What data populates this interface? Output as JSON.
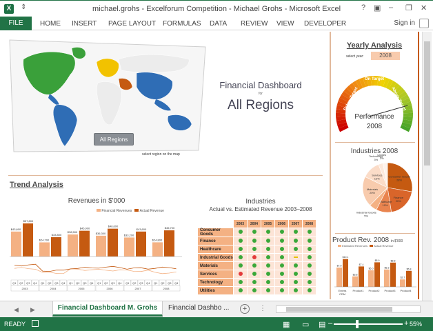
{
  "window": {
    "title": "michael.grohs - Excelforum Competition - Michael Grohs - Microsoft Excel",
    "help": "?",
    "minimize": "–",
    "restore": "❐",
    "close": "✕"
  },
  "ribbon": {
    "file": "FILE",
    "tabs": [
      "HOME",
      "INSERT",
      "PAGE LAYOUT",
      "FORMULAS",
      "DATA",
      "REVIEW",
      "VIEW",
      "DEVELOPER"
    ],
    "signin": "Sign in"
  },
  "dashboard": {
    "title": "Financial Dashboard",
    "for": "for",
    "region": "All Regions",
    "map_button": "All Regions",
    "map_hint": "select region on the map",
    "colors": {
      "americas": "#2f6db5",
      "north": "#3aa03a",
      "europe": "#f2c200",
      "mideast": "#c55a11",
      "asia": "#2f6db5"
    }
  },
  "trend": {
    "title": "Trend Analysis",
    "revenue_title": "Revenues in $'000",
    "legend_fin": "Financial Revenues",
    "legend_act": "Actual Revenue"
  },
  "chart_data": {
    "type": "bar",
    "title": "Revenues in $'000",
    "categories": [
      "2003",
      "2004",
      "2005",
      "2006",
      "2007",
      "2008"
    ],
    "series": [
      {
        "name": "Financial Revenues",
        "values": [
          43600,
          24700,
          38500,
          36300,
          33200,
          24800
        ]
      },
      {
        "name": "Actual Revenue",
        "values": [
          57800,
          33800,
          45000,
          48600,
          43600,
          45700
        ]
      }
    ],
    "labels": {
      "fin": [
        "$43,600",
        "$24,700",
        "$38,500",
        "$36,300",
        "$33,200",
        "$24,800"
      ],
      "act": [
        "$57,800",
        "$33,800",
        "$45,000",
        "$48,600",
        "$43,600",
        "$45,700"
      ]
    },
    "quarters": [
      "Q1",
      "Q2",
      "Q3",
      "Q4"
    ],
    "ylim": [
      0,
      65000
    ]
  },
  "industries": {
    "title": "Industries",
    "subtitle": "Actual vs. Estimated Revenue 2003–2008",
    "years": [
      "2003",
      "2004",
      "2005",
      "2006",
      "2007",
      "2008"
    ],
    "rows": [
      {
        "label": "Consumer Goods",
        "status": [
          "g",
          "g",
          "g",
          "g",
          "g",
          "g"
        ]
      },
      {
        "label": "Finance",
        "status": [
          "g",
          "g",
          "g",
          "g",
          "g",
          "g"
        ]
      },
      {
        "label": "Healthcare",
        "status": [
          "g",
          "g",
          "g",
          "g",
          "g",
          "g"
        ]
      },
      {
        "label": "Industrial Goods",
        "status": [
          "g",
          "r",
          "g",
          "g",
          "y",
          "g"
        ]
      },
      {
        "label": "Materials",
        "status": [
          "g",
          "g",
          "g",
          "g",
          "g",
          "g"
        ]
      },
      {
        "label": "Services",
        "status": [
          "r",
          "g",
          "g",
          "g",
          "g",
          "g"
        ]
      },
      {
        "label": "Technology",
        "status": [
          "g",
          "g",
          "g",
          "g",
          "g",
          "g"
        ]
      },
      {
        "label": "Utilities",
        "status": [
          "g",
          "g",
          "g",
          "g",
          "g",
          "g"
        ]
      }
    ]
  },
  "yearly": {
    "title": "Yearly Analysis",
    "select_label": "select year:",
    "year": "2008",
    "below": "Below Target",
    "on": "On Target",
    "above": "Above Target",
    "performance": "Performance",
    "perf_year": "2008",
    "needle_fraction": 0.82
  },
  "industries2008": {
    "title": "Industries 2008",
    "slices": [
      {
        "label": "Consumer Goods",
        "pct": 28,
        "text": "Consumer Goods 28%",
        "color": "#c55a11"
      },
      {
        "label": "Finance",
        "pct": 20,
        "text": "Finance 20%",
        "color": "#d9652a"
      },
      {
        "label": "Healthcare",
        "pct": 10,
        "text": "Healthcare 10%",
        "color": "#e9844f"
      },
      {
        "label": "Industrial Goods",
        "pct": 5,
        "text": "Industrial Goods 5%",
        "color": "#f4b183"
      },
      {
        "label": "Materials",
        "pct": 20,
        "text": "Materials 20%",
        "color": "#f8cbad"
      },
      {
        "label": "Services",
        "pct": 12,
        "text": "Services 12%",
        "color": "#fbdcc8"
      },
      {
        "label": "Technology",
        "pct": 3,
        "text": "Technology 3%",
        "color": "#fde9dc"
      },
      {
        "label": "Utilities",
        "pct": 3,
        "text": "Utilities 3%",
        "color": "#fef3ec"
      }
    ]
  },
  "product": {
    "title": "Product Rev. 2008",
    "unit": "in $'000",
    "legend_est": "Estimated Revenues",
    "legend_act": "Actual Revenue",
    "products": [
      "Entera CRM",
      "Product1",
      "Product2",
      "Product3",
      "Product4"
    ],
    "est": [
      7.0,
      3.8,
      6.0,
      6.3,
      2.7
    ],
    "act": [
      10.1,
      7.4,
      8.9,
      8.8,
      5.8
    ],
    "est_labels": [
      "$7.0",
      "$3.8",
      "$6.0",
      "$6.3",
      "$2.7"
    ],
    "act_labels": [
      "$10.1",
      "$7.4",
      "$8.9",
      "$8.8",
      "$5.8"
    ],
    "ylim": [
      0,
      12
    ]
  },
  "sheets": {
    "active": "Financial Dashboard M. Grohs",
    "other": "Financial Dashbo ...",
    "add": "+"
  },
  "status": {
    "ready": "READY",
    "zoom": "55%",
    "zoom_fraction": 0.55
  }
}
